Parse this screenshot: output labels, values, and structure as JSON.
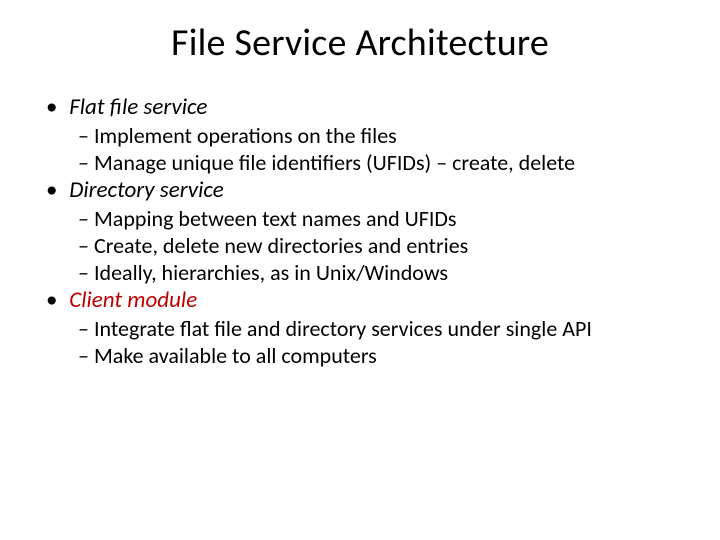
{
  "title": "File Service Architecture",
  "sections": [
    {
      "heading": "Flat file service",
      "red": false,
      "items": [
        "Implement operations on the files",
        "Manage unique file identifiers (UFIDs) – create, delete"
      ]
    },
    {
      "heading": "Directory service",
      "red": false,
      "items": [
        "Mapping between text names and UFIDs",
        "Create, delete new directories and entries",
        "Ideally, hierarchies, as in Unix/Windows"
      ]
    },
    {
      "heading": "Client module",
      "red": true,
      "items": [
        "Integrate flat file and directory services under single API",
        "Make available to all computers"
      ]
    }
  ]
}
